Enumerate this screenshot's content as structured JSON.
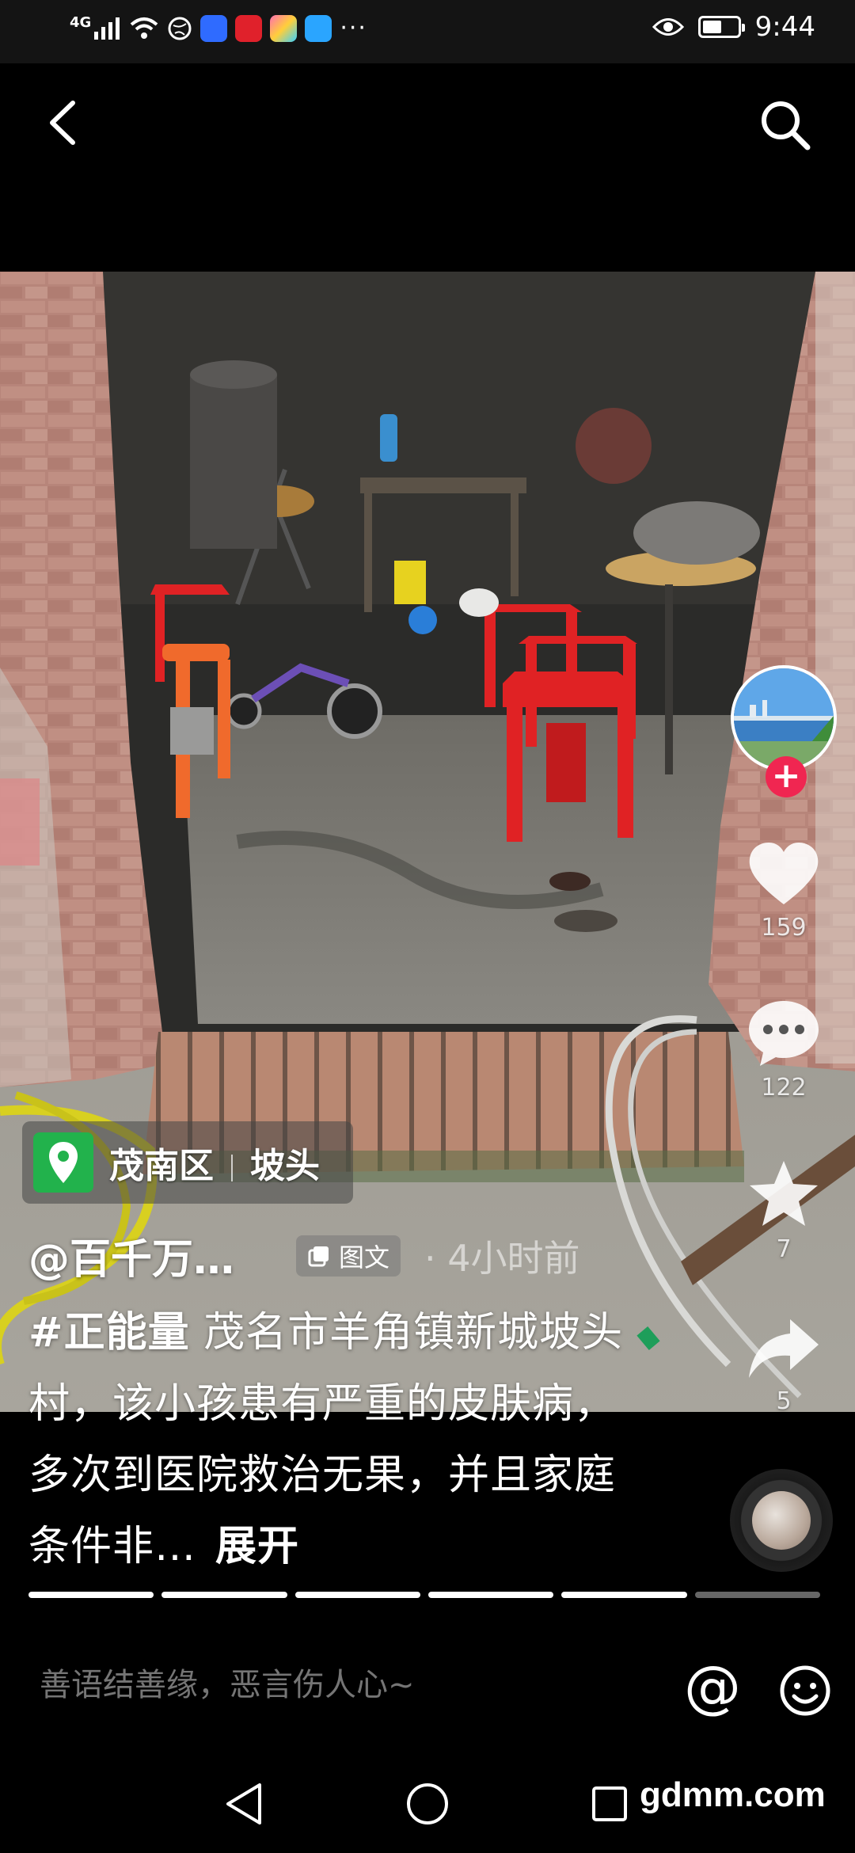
{
  "status_bar": {
    "network": "4G",
    "time": "9:44",
    "battery_level": 0.55,
    "app_colors": [
      "#2f6bff",
      "#e0212b",
      "#f0a030",
      "#2aa5ff"
    ]
  },
  "nav": {
    "back_icon": "chevron-left-icon",
    "search_icon": "search-icon"
  },
  "sidebar": {
    "likes": "159",
    "comments": "122",
    "favorites": "7",
    "shares": "5",
    "follow_color": "#f02651"
  },
  "post": {
    "location_district": "茂南区",
    "location_place": "坡头",
    "author": "@百千万…",
    "type_badge": "图文",
    "time_sep": "·",
    "time_ago": "4小时前",
    "hashtag": "#正能量",
    "description": " 茂名市羊角镇新城坡头村，该小孩患有严重的皮肤病，多次到医院救治无果，并且家庭条件非…",
    "expand_label": "展开"
  },
  "progress": {
    "total_pages": 6,
    "current_page": 5
  },
  "comment_bar": {
    "placeholder": "善语结善缘，恶言伤人心~",
    "at_label": "@"
  },
  "watermark": "gdmm.com"
}
